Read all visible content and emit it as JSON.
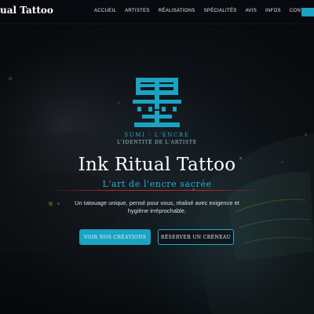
{
  "nav": {
    "brand": "ual Tattoo",
    "links": [
      "ACCUEIL",
      "ARTISTES",
      "RÉALISATIONS",
      "SPÉCIALITÉS",
      "AVIS",
      "INFOS",
      "CONTACT"
    ]
  },
  "logo": {
    "icon": "sumi-ink-kanji-icon",
    "line1": "SUMI · L'ENCRE",
    "line2": "L'IDENTITÉ DE L'ARTISTE"
  },
  "hero": {
    "title": "Ink Ritual Tattoo",
    "subtitle": "L'art de l'encre sacrée",
    "tagline": "Un tatouage unique, pensé pour vous, réalisé avec exigence et hygiène irréprochable.",
    "primary_button": "VOIR NOS CRÉATIONS",
    "secondary_button": "RÉSERVER UN CRÉNEAU"
  },
  "colors": {
    "accent": "#1aa3c2",
    "divider": "#c82832",
    "background": "#0a0d12"
  }
}
